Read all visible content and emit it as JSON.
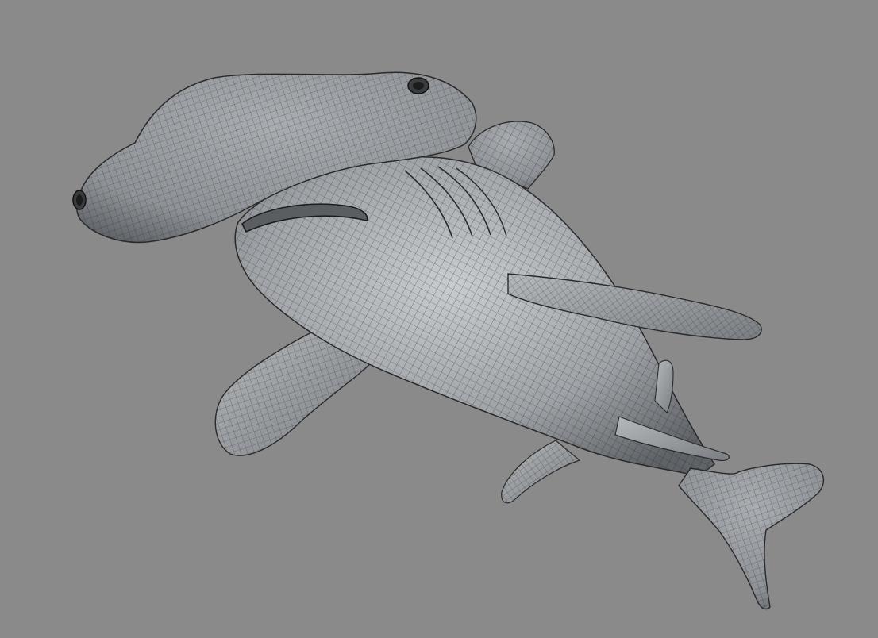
{
  "scene": {
    "subject": "hammerhead-shark-wireframe-model",
    "render_mode": "shaded-wireframe",
    "background_color": "#8a8a8a",
    "surface_color": "#9ea2a6",
    "highlight_color": "#c8cccf",
    "shadow_color": "#5f6367",
    "wire_color": "#1c1c1c"
  }
}
